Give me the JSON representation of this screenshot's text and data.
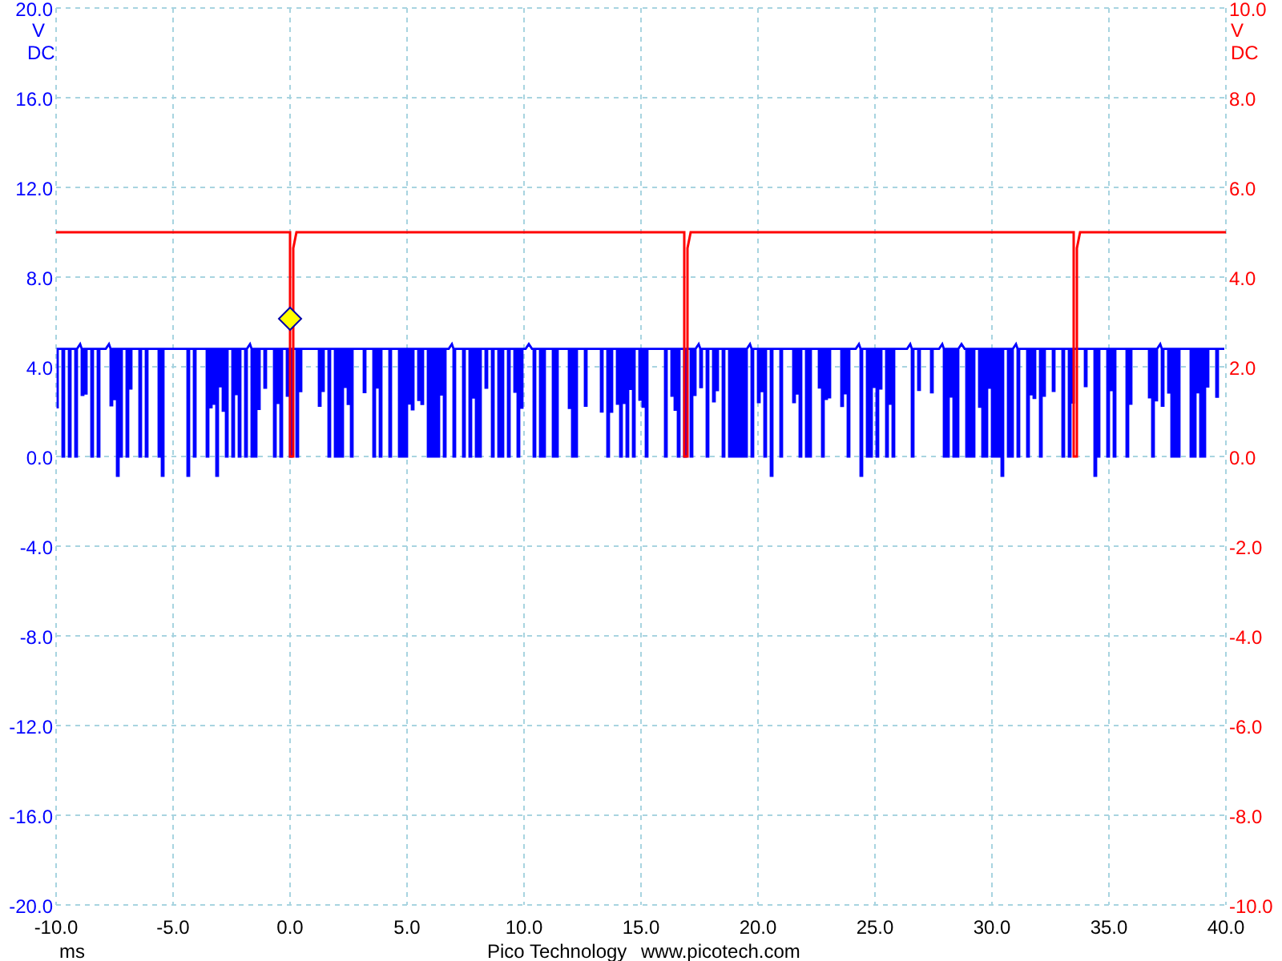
{
  "channels": [
    {
      "color": "#0000ff",
      "unit": "V",
      "coupling": "DC",
      "axis_labels": [
        "20.0",
        "16.0",
        "12.0",
        "8.0",
        "4.0",
        "0.0",
        "-4.0",
        "-8.0",
        "-12.0",
        "-16.0",
        "-20.0"
      ]
    },
    {
      "color": "#ff0000",
      "unit": "V",
      "coupling": "DC",
      "axis_labels": [
        "10.0",
        "8.0",
        "6.0",
        "4.0",
        "2.0",
        "0.0",
        "-2.0",
        "-4.0",
        "-6.0",
        "-8.0",
        "-10.0"
      ]
    }
  ],
  "x_axis": {
    "labels": [
      "-10.0",
      "-5.0",
      "0.0",
      "5.0",
      "10.0",
      "15.0",
      "20.0",
      "25.0",
      "30.0",
      "35.0",
      "40.0"
    ],
    "unit": "ms"
  },
  "footer": {
    "company": "Pico Technology",
    "website": "www.picotech.com"
  }
}
